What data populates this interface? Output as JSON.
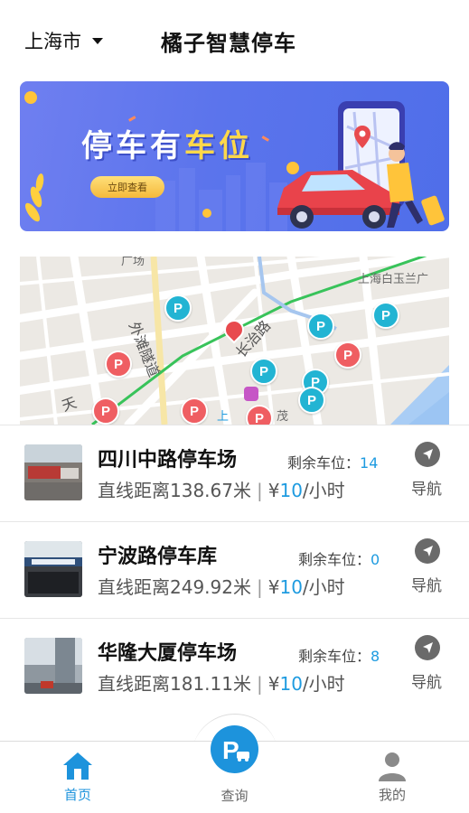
{
  "header": {
    "city": "上海市",
    "title": "橘子智慧停车"
  },
  "banner": {
    "slogan_a": "停车",
    "slogan_b": "有",
    "slogan_c": "车位",
    "button_label": "立即查看",
    "bg_color": "#5b74ec"
  },
  "map": {
    "labels": {
      "top": "广场",
      "shanghai_baiyulan": "上海白玉兰广",
      "waitan_tunnel": "外滩隧道",
      "changzhi_road": "长治路",
      "tian": "天",
      "shang": "上",
      "mao": "茂"
    }
  },
  "lots": [
    {
      "name": "四川中路停车场",
      "remain_label": "剩余车位：",
      "remain": "14",
      "distance_label": "直线距离",
      "distance": "138.67米",
      "price_prefix": "¥",
      "price": "10",
      "price_unit": "/小时",
      "nav_label": "导航"
    },
    {
      "name": "宁波路停车库",
      "remain_label": "剩余车位：",
      "remain": "0",
      "distance_label": "直线距离",
      "distance": "249.92米",
      "price_prefix": "¥",
      "price": "10",
      "price_unit": "/小时",
      "nav_label": "导航"
    },
    {
      "name": "华隆大厦停车场",
      "remain_label": "剩余车位：",
      "remain": "8",
      "distance_label": "直线距离",
      "distance": "181.11米",
      "price_prefix": "¥",
      "price": "10",
      "price_unit": "/小时",
      "nav_label": "导航"
    }
  ],
  "tabbar": {
    "home_label": "首页",
    "query_label": "查询",
    "mine_label": "我的",
    "accent_color": "#1d93dc"
  },
  "icons": {
    "home": "home-icon",
    "parking": "parking-car-icon",
    "user": "user-icon",
    "navigate": "navigation-arrow-icon",
    "location": "location-pin-icon"
  }
}
